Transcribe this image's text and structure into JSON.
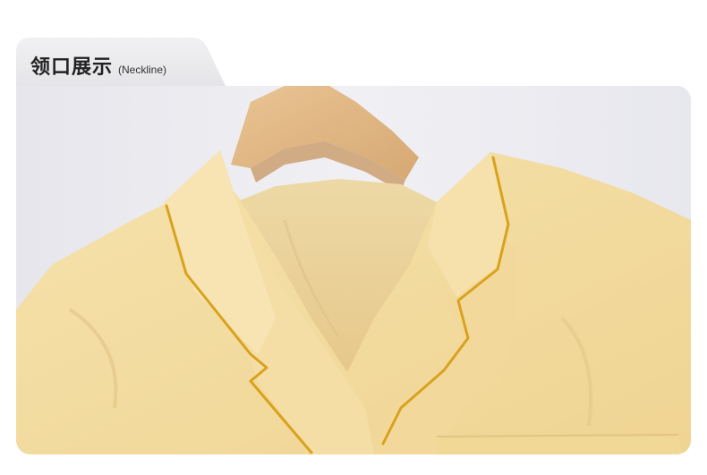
{
  "section": {
    "title_cn": "领口展示",
    "title_en": "(Neckline)"
  },
  "photo": {
    "subject": "shirt-collar-on-wooden-hanger",
    "colors": {
      "background": "#ebebf1",
      "fabric": "#f3dca0",
      "fabric_shadow": "#e2c684",
      "piping": "#d9a21d",
      "hanger": "#e0b784",
      "hanger_shadow": "#c9996a",
      "inner_neck": "#e9cf94"
    }
  }
}
